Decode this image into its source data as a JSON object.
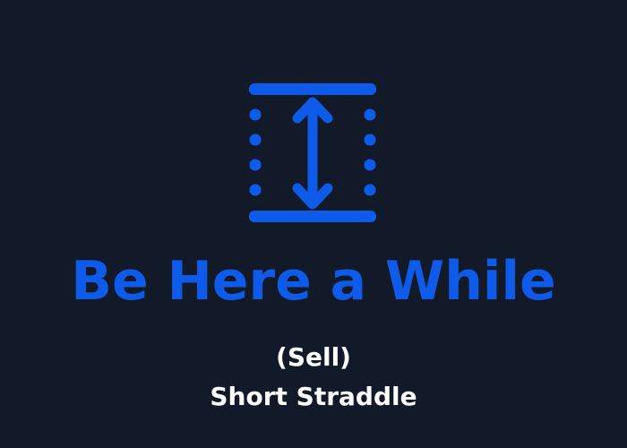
{
  "colors": {
    "background": "#121a2a",
    "accent": "#0e5bea",
    "text": "#ffffff"
  },
  "icon": {
    "name": "vertical-range-arrows-icon"
  },
  "title": "Be Here a While",
  "subtitle_line1": "(Sell)",
  "subtitle_line2": "Short Straddle"
}
